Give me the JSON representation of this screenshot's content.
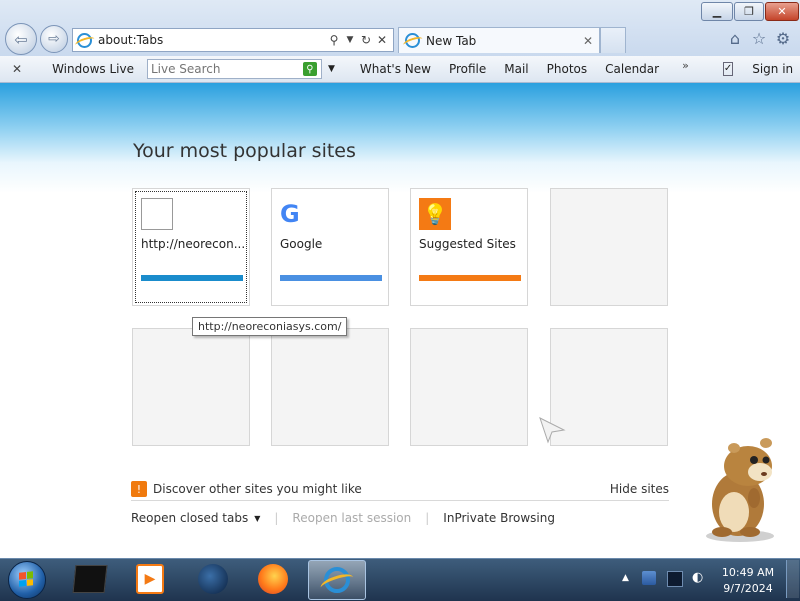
{
  "address_bar": {
    "url": "about:Tabs"
  },
  "tabs": [
    {
      "label": "New Tab"
    }
  ],
  "command_bar": {
    "brand_label": "Windows Live",
    "search_placeholder": "Live Search",
    "links": [
      "What's New",
      "Profile",
      "Mail",
      "Photos",
      "Calendar"
    ],
    "overflow": "»",
    "sign_in": "Sign in"
  },
  "main": {
    "title": "Your most popular sites",
    "tiles": [
      {
        "label": "http://neorecon...",
        "bar_color": "#1a8ccc"
      },
      {
        "label": "Google",
        "bar_color": "#4a90e2"
      },
      {
        "label": "Suggested Sites",
        "bar_color": "#f47a14"
      }
    ],
    "tooltip": "http://neoreconiasys.com/",
    "discover_label": "Discover other sites you might like",
    "hide_sites": "Hide sites",
    "reopen_closed_tabs": "Reopen closed tabs",
    "reopen_last_session": "Reopen last session",
    "inprivate": "InPrivate Browsing"
  },
  "taskbar": {
    "time": "10:49 AM",
    "date": "9/7/2024"
  },
  "icons": {
    "back": "back-arrow-icon",
    "forward": "forward-arrow-icon",
    "home": "home-icon",
    "favorites": "star-icon",
    "tools": "gear-icon"
  },
  "colors": {
    "accent_blue": "#1a8ccc",
    "google_blue": "#4a90e2",
    "suggested_orange": "#f47a14"
  }
}
